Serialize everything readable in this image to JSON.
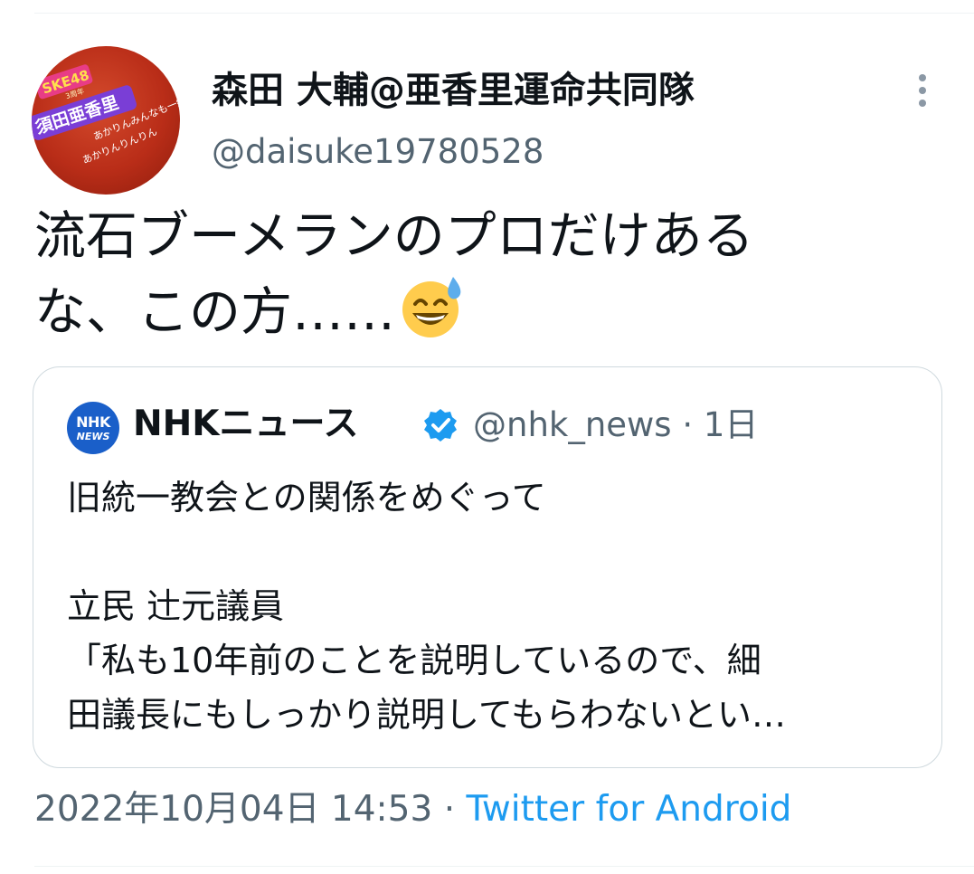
{
  "tweet": {
    "display_name": "森田 大輔@亜香里運命共同隊",
    "handle": "@daisuke19780528",
    "text_lines": [
      "流石ブーメランのプロだけある",
      "な、この方……"
    ],
    "emoji": "grinning-face-with-sweat",
    "timestamp": "2022年10月04日 14:53",
    "separator": " · ",
    "source": "Twitter for Android"
  },
  "avatar": {
    "text_lines": [
      "SKE48",
      "3周年",
      "須田亜香里",
      "あかりんみんなも一緒に？",
      "あかりんりんりん"
    ]
  },
  "quoted_tweet": {
    "logo_text": [
      "NHK",
      "NEWS"
    ],
    "display_name": "NHKニュース",
    "handle": "@nhk_news",
    "time": " · 1日",
    "body_lines": [
      "旧統一教会との関係をめぐって",
      "",
      "立民 辻元議員",
      "「私も10年前のことを説明しているので、細",
      "田議長にもしっかり説明してもらわないとい…"
    ]
  },
  "colors": {
    "text": "#0f1419",
    "secondary": "#536471",
    "link": "#1d9bf0",
    "border": "#cfd9de",
    "verified": "#1d9bf0"
  }
}
